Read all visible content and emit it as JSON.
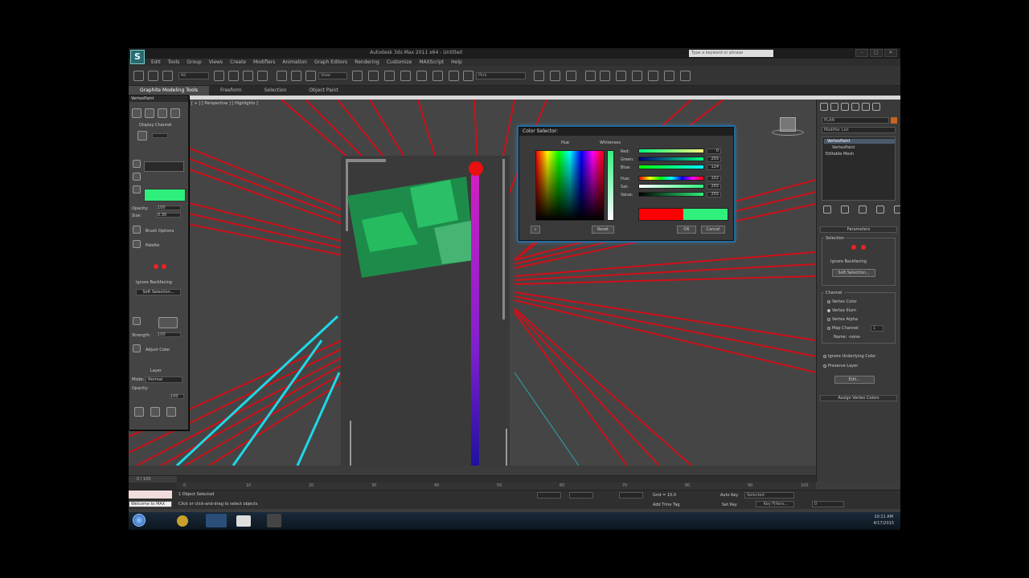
{
  "window": {
    "title": "Autodesk 3ds Max 2011 x64 - Untitled",
    "search_placeholder": "Type a keyword or phrase"
  },
  "menu": [
    "Edit",
    "Tools",
    "Group",
    "Views",
    "Create",
    "Modifiers",
    "Animation",
    "Graph Editors",
    "Rendering",
    "Customize",
    "MAXScript",
    "Help"
  ],
  "toolbar": {
    "selection_filter": "All",
    "reference_coord": "View",
    "named_selection": "Pink"
  },
  "ribbon": {
    "tabs": [
      "Graphite Modeling Tools",
      "Freeform",
      "Selection",
      "Object Paint"
    ]
  },
  "viewport": {
    "label": "[ + ] [ Perspective ] [ Highlights ]"
  },
  "vertex_paint_panel": {
    "title": "VertexPaint",
    "display_channel": "Display Channel",
    "opacity_label": "Opacity:",
    "opacity_value": "100",
    "size_label": "Size:",
    "size_value": "0.30",
    "brush_options": "Brush Options",
    "palette": "Palette",
    "ignore_backfacing": "Ignore Backfacing",
    "soft_selection": "Soft Selection...",
    "strength_label": "Strength:",
    "strength_value": "100",
    "adjust_color": "Adjust Color",
    "layer_label": "Layer",
    "mode_label": "Mode:",
    "mode_value": "Normal",
    "opacity2_label": "Opacity:",
    "opacity2_value": "100",
    "paint_color": "#2ff07c"
  },
  "color_selector": {
    "title": "Color Selector:",
    "hue_label": "Hue",
    "whiteness_label": "Whiteness",
    "labels": [
      "Red:",
      "Green:",
      "Blue:",
      "Hue:",
      "Sat:",
      "Value:"
    ],
    "values": [
      "0",
      "255",
      "124",
      "102",
      "255",
      "255"
    ],
    "reset": "Reset",
    "ok": "OK",
    "cancel": "Cancel",
    "old_color": "#ff0000",
    "new_color": "#2ff07c"
  },
  "command_panel": {
    "object_name": "PLAN",
    "modifier_list": "Modifier List",
    "stack": [
      "VertexPaint",
      "VertexPaint",
      "Editable Mesh"
    ],
    "parameters": "Parameters",
    "selection": "Selection",
    "ignore_backfacing": "Ignore Backfacing",
    "soft_selection": "Soft Selection...",
    "channel": "Channel",
    "channel_options": [
      "Vertex Color",
      "Vertex Illum",
      "Vertex Alpha",
      "Map Channel"
    ],
    "map_channel_value": "1",
    "name_label": "Name: -none-",
    "ignore_underlying": "Ignore Underlying Color",
    "preserve_layer": "Preserve Layer",
    "edit": "Edit...",
    "assign_vertex_colors": "Assign Vertex Colors"
  },
  "timeline": {
    "frame_label": "0 / 100",
    "ticks": [
      "0",
      "10",
      "20",
      "30",
      "40",
      "50",
      "60",
      "70",
      "80",
      "90",
      "100"
    ]
  },
  "status": {
    "selected": "1 Object Selected",
    "prompt": "Click or click-and-drag to select objects",
    "grid": "Grid = 10.0",
    "add_time_tag": "Add Time Tag",
    "auto_key": "Auto Key",
    "set_key": "Set Key",
    "key_filters": "Key Filters...",
    "selected_dropdown": "Selected",
    "frame": "0",
    "welcome": "Welcome to MAX"
  },
  "taskbar": {
    "time": "10:11 AM",
    "date": "4/17/2015"
  }
}
